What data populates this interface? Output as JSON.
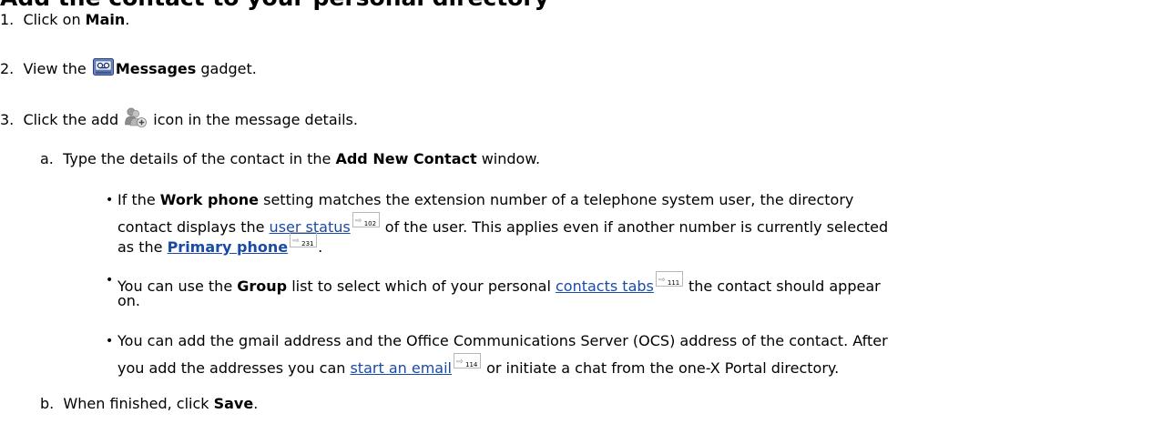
{
  "heading": "Add the contact to your personal directory",
  "steps": [
    {
      "num": "1.",
      "pre": "Click on ",
      "bold": "Main",
      "post": "."
    },
    {
      "num": "2.",
      "pre": "View the ",
      "icon": "messages-gadget-icon",
      "bold": "Messages",
      "post": " gadget."
    },
    {
      "num": "3.",
      "pre": "Click the add ",
      "icon": "add-contact-icon",
      "post": " icon in the message details."
    }
  ],
  "substeps": {
    "a": {
      "letter": "a.",
      "pre": "Type the details of the contact in the ",
      "bold": "Add New Contact",
      "post": " window."
    },
    "b": {
      "letter": "b.",
      "pre": "When finished, click ",
      "bold": "Save",
      "post": "."
    }
  },
  "bullets": {
    "work_phone": {
      "line1_pre": "If the ",
      "line1_bold": "Work phone",
      "line1_post": " setting matches the extension number of a telephone system user, the directory",
      "line2_pre": "contact displays the ",
      "line2_link": "user status",
      "line2_ref": "102",
      "line2_post": " of the user. This applies even if another number is currently selected",
      "line3_pre": "as the ",
      "line3_link": "Primary phone",
      "line3_ref": "231",
      "line3_post": "."
    },
    "group": {
      "line1_pre": "You can use the ",
      "line1_bold": "Group",
      "line1_mid": " list to select which of your personal ",
      "line1_link": "contacts tabs",
      "line1_ref": "111",
      "line1_post": " the contact should appear",
      "line2": "on."
    },
    "gmail": {
      "line1": "You can add the gmail address and the Office Communications Server (OCS) address of the contact. After",
      "line2_pre": "you add the addresses you can ",
      "line2_link": "start an email",
      "line2_ref": "114",
      "line2_post": " or initiate a chat from the one-X Portal directory."
    }
  },
  "icons": {
    "bullet": "•",
    "ref_arrow": "⇨",
    "link_color": "#1a4aa8"
  }
}
